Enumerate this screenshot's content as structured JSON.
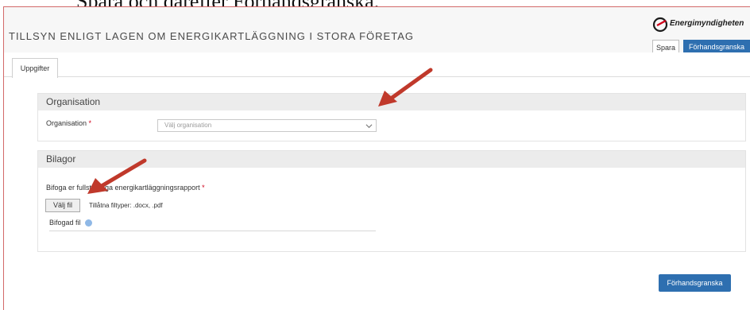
{
  "caption": "Spara och därefter Förhandsgranska.",
  "header": {
    "title": "TILLSYN ENLIGT LAGEN OM ENERGIKARTLÄGGNING I STORA FÖRETAG",
    "logo_text": "Energimyndigheten",
    "save_label": "Spara",
    "preview_label": "Förhandsgranska"
  },
  "tabs": [
    {
      "label": "Uppgifter"
    }
  ],
  "organisation": {
    "heading": "Organisation",
    "field_label": "Organisation",
    "required_mark": "*",
    "select_placeholder": "Välj organisation"
  },
  "bilagor": {
    "heading": "Bilagor",
    "attach_label": "Bifoga er fullständiga energikartläggningsrapport",
    "required_mark": "*",
    "choose_file_label": "Välj fil",
    "allowed_types": "Tillåtna filtyper: .docx, .pdf",
    "attached_file_label": "Bifogad fil"
  },
  "footer": {
    "preview_label": "Förhandsgranska"
  },
  "colors": {
    "primary": "#2e6fb0",
    "required": "#d0021b",
    "annotation_arrow": "#c0392b"
  }
}
